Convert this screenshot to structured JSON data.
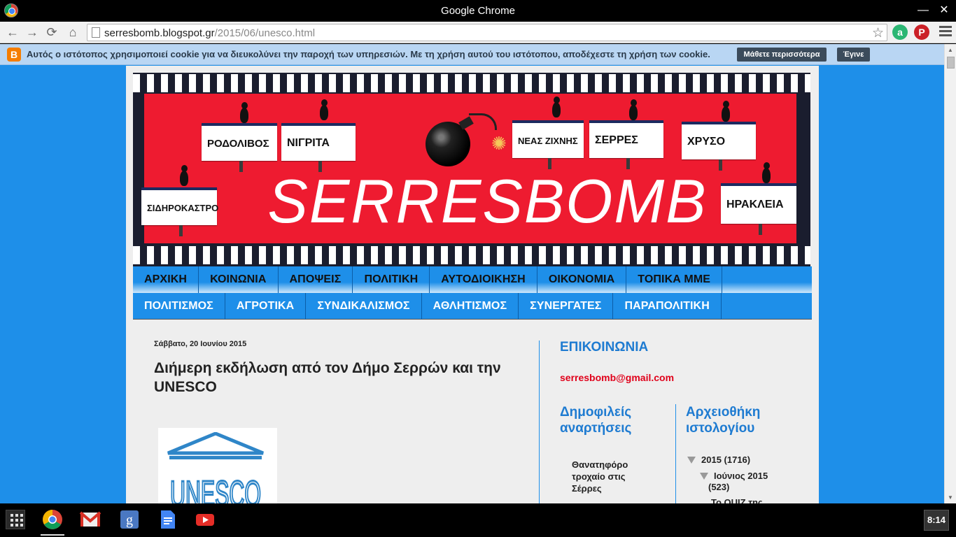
{
  "window": {
    "title": "Google Chrome"
  },
  "browser": {
    "url_host": "serresbomb.blogspot.gr",
    "url_path": "/2015/06/unesco.html"
  },
  "cookie_bar": {
    "message": "Αυτός ο ιστότοπος χρησιμοποιεί cookie για να διευκολύνει την παροχή των υπηρεσιών. Με τη χρήση αυτού του ιστότοπου, αποδέχεστε τη χρήση των cookie.",
    "learn_more": "Μάθετε περισσότερα",
    "accept": "Έγινε"
  },
  "header": {
    "logo": "SERRESBOMB",
    "signs": [
      "ΡΟΔΟΛΙΒΟΣ",
      "ΝΙΓΡΙΤΑ",
      "ΝΕΑΣ ΖΙΧΝΗΣ",
      "ΣΕΡΡΕΣ",
      "ΧΡΥΣΟ",
      "ΣΙΔΗΡΟΚΑΣΤΡΟ",
      "ΗΡΑΚΛΕΙΑ"
    ]
  },
  "nav": {
    "row1": [
      "ΑΡΧΙΚΗ",
      "ΚΟΙΝΩΝΙΑ",
      "ΑΠΟΨΕΙΣ",
      "ΠΟΛΙΤΙΚΗ",
      "ΑΥΤΟΔΙΟΙΚΗΣΗ",
      "ΟΙΚΟΝΟΜΙΑ",
      "ΤΟΠΙΚΑ ΜΜΕ"
    ],
    "row2": [
      "ΠΟΛΙΤΙΣΜΟΣ",
      "ΑΓΡΟΤΙΚΑ",
      "ΣΥΝΔΙΚΑΛΙΣΜΟΣ",
      "ΑΘΛΗΤΙΣΜΟΣ",
      "ΣΥΝΕΡΓΑΤΕΣ",
      "ΠΑΡΑΠΟΛΙΤΙΚΗ"
    ]
  },
  "post": {
    "date": "Σάββατο, 20 Ιουνίου 2015",
    "title": "Διήμερη εκδήλωση από τον Δήμο Σερρών και την UNESCO",
    "image_text": "UNESCO"
  },
  "sidebar": {
    "contact_title": "ΕΠΙΚΟΙΝΩΝΙΑ",
    "email": "serresbomb@gmail.com",
    "popular_title": "Δημοφιλείς αναρτήσεις",
    "popular_post": "Θανατηφόρο τροχαίο στις Σέρρες",
    "archive_title": "Αρχειοθήκη ιστολογίου",
    "archive_year": "2015 (1716)",
    "archive_month": "Ιούνιος 2015",
    "archive_month_count": "(523)",
    "archive_next": "Το QUIZ της"
  },
  "taskbar": {
    "apps": [
      "chrome-icon",
      "gmail-icon",
      "google-search-icon",
      "docs-icon",
      "youtube-icon"
    ],
    "clock": "8:14"
  },
  "colors": {
    "page_background": "#1e8fe9",
    "link_blue": "#1e7bd1",
    "email_red": "#e0001a",
    "header_red": "#ee1b30"
  }
}
